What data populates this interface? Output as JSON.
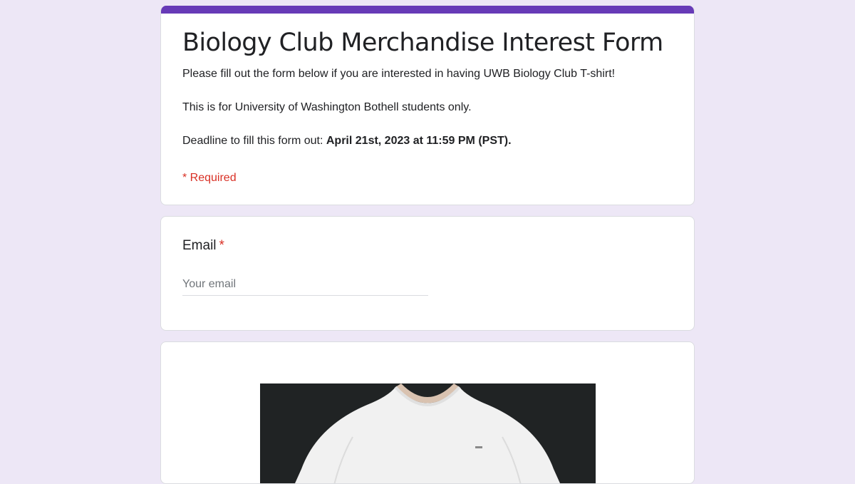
{
  "form": {
    "accent_color": "#673ab7",
    "title": "Biology Club Merchandise Interest Form",
    "description": {
      "line1": "Please fill out the form below if you are interested in having UWB Biology Club T-shirt!",
      "line2": "This is for University of Washington Bothell students only.",
      "line3_prefix": "Deadline to fill this form out: ",
      "line3_bold": "April 21st, 2023 at 11:59 PM (PST)."
    },
    "required_note": "* Required"
  },
  "questions": {
    "email": {
      "label": "Email",
      "required_marker": "*",
      "placeholder": "Your email",
      "value": ""
    }
  },
  "image_section": {
    "icon": "tshirt-photo"
  }
}
